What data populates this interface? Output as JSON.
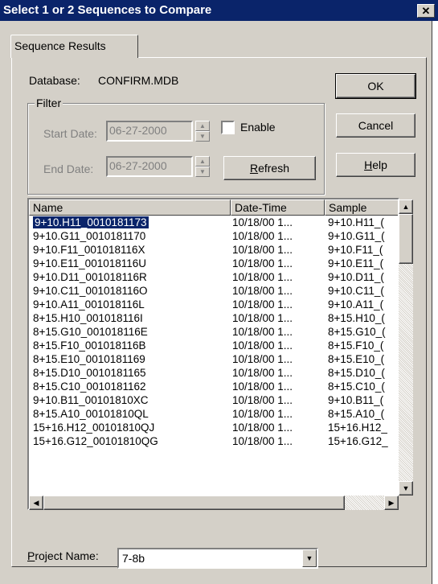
{
  "window": {
    "title": "Select 1 or 2 Sequences to Compare",
    "close_glyph": "✕"
  },
  "tab": {
    "label": "Sequence Results"
  },
  "database": {
    "label": "Database:",
    "value": "CONFIRM.MDB"
  },
  "filter": {
    "title": "Filter",
    "start_label": "Start Date:",
    "start_value": "06-27-2000",
    "end_label": "End Date:",
    "end_value": "06-27-2000",
    "enable_label": "Enable",
    "enable_checked": false,
    "refresh_pre": "",
    "refresh_mnemonic": "R",
    "refresh_post": "efresh"
  },
  "buttons": {
    "ok": "OK",
    "cancel": "Cancel",
    "help_mnemonic": "H",
    "help_post": "elp"
  },
  "table": {
    "columns": [
      "Name",
      "Date-Time",
      "Sample"
    ],
    "rows": [
      [
        "9+10.H11_0010181173",
        "10/18/00 1...",
        "9+10.H11_("
      ],
      [
        "9+10.G11_0010181170",
        "10/18/00 1...",
        "9+10.G11_("
      ],
      [
        "9+10.F11_001018116X",
        "10/18/00 1...",
        "9+10.F11_("
      ],
      [
        "9+10.E11_001018116U",
        "10/18/00 1...",
        "9+10.E11_("
      ],
      [
        "9+10.D11_001018116R",
        "10/18/00 1...",
        "9+10.D11_("
      ],
      [
        "9+10.C11_001018116O",
        "10/18/00 1...",
        "9+10.C11_("
      ],
      [
        "9+10.A11_001018116L",
        "10/18/00 1...",
        "9+10.A11_("
      ],
      [
        "8+15.H10_001018116I",
        "10/18/00 1...",
        "8+15.H10_("
      ],
      [
        "8+15.G10_001018116E",
        "10/18/00 1...",
        "8+15.G10_("
      ],
      [
        "8+15.F10_001018116B",
        "10/18/00 1...",
        "8+15.F10_("
      ],
      [
        "8+15.E10_0010181169",
        "10/18/00 1...",
        "8+15.E10_("
      ],
      [
        "8+15.D10_0010181165",
        "10/18/00 1...",
        "8+15.D10_("
      ],
      [
        "8+15.C10_0010181162",
        "10/18/00 1...",
        "8+15.C10_("
      ],
      [
        "9+10.B11_00101810XC",
        "10/18/00 1...",
        "9+10.B11_("
      ],
      [
        "8+15.A10_00101810QL",
        "10/18/00 1...",
        "8+15.A10_("
      ],
      [
        "15+16.H12_00101810QJ",
        "10/18/00 1...",
        "15+16.H12_"
      ],
      [
        "15+16.G12_00101810QG",
        "10/18/00 1...",
        "15+16.G12_"
      ]
    ],
    "selected_row": 0
  },
  "project": {
    "label_mnemonic": "P",
    "label_post": "roject Name:",
    "value": "7-8b"
  },
  "icons": {
    "up": "up-arrow-icon",
    "down": "down-arrow-icon",
    "left": "left-arrow-icon",
    "right": "right-arrow-icon"
  }
}
